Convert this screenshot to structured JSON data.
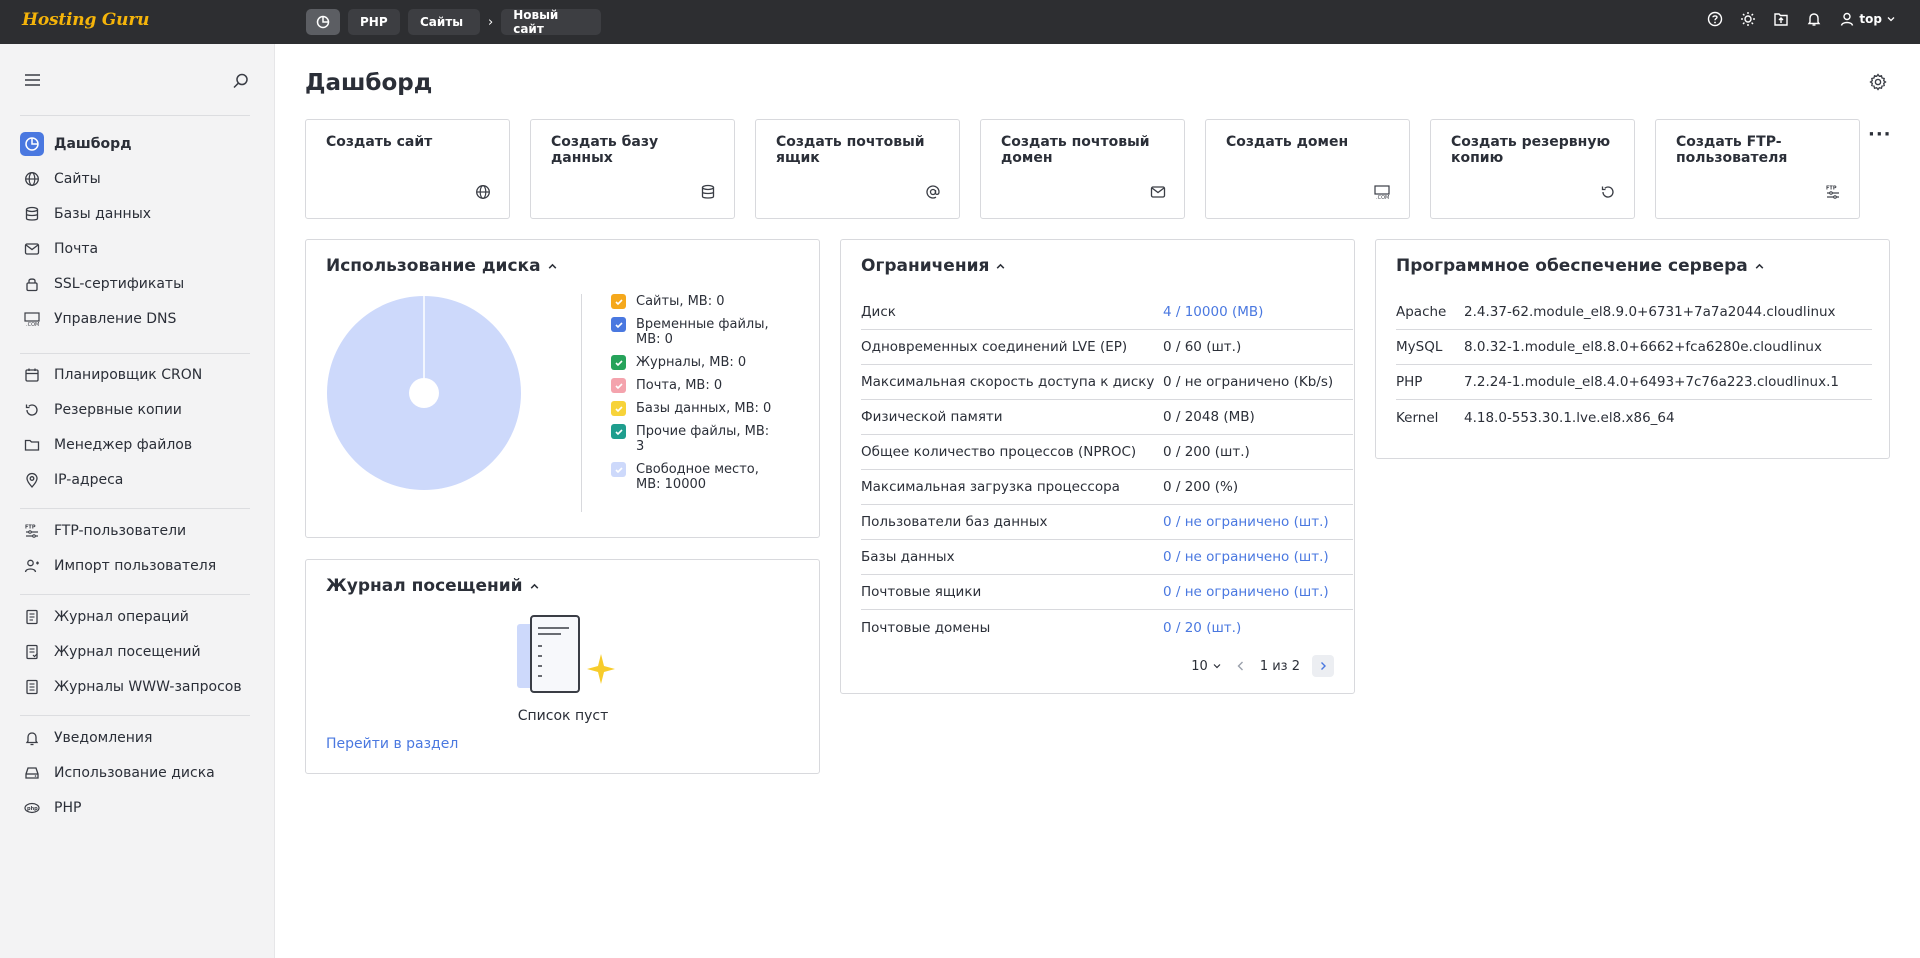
{
  "header": {
    "logo": "Hosting Guru",
    "breadcrumbs": [
      "PHP",
      "Сайты",
      "Новый сайт"
    ],
    "user": "top"
  },
  "sidebar": {
    "items": [
      {
        "label": "Дашборд",
        "icon": "dashboard-icon",
        "active": true
      },
      {
        "label": "Сайты",
        "icon": "globe-icon"
      },
      {
        "label": "Базы данных",
        "icon": "database-icon"
      },
      {
        "label": "Почта",
        "icon": "mail-icon"
      },
      {
        "label": "SSL-сертификаты",
        "icon": "lock-icon"
      },
      {
        "label": "Управление DNS",
        "icon": "dns-icon"
      },
      {
        "label": "Планировщик CRON",
        "icon": "calendar-icon"
      },
      {
        "label": "Резервные копии",
        "icon": "backup-icon"
      },
      {
        "label": "Менеджер файлов",
        "icon": "folder-icon"
      },
      {
        "label": "IP-адреса",
        "icon": "location-icon"
      },
      {
        "label": "FTP-пользователи",
        "icon": "ftp-icon"
      },
      {
        "label": "Импорт пользователя",
        "icon": "user-import-icon"
      },
      {
        "label": "Журнал операций",
        "icon": "log-icon"
      },
      {
        "label": "Журнал посещений",
        "icon": "visits-log-icon"
      },
      {
        "label": "Журналы WWW-запросов",
        "icon": "www-log-icon"
      },
      {
        "label": "Уведомления",
        "icon": "bell-icon"
      },
      {
        "label": "Использование диска",
        "icon": "disk-icon"
      },
      {
        "label": "PHP",
        "icon": "php-icon"
      }
    ]
  },
  "page": {
    "title": "Дашборд"
  },
  "quick_actions": [
    {
      "label": "Создать сайт",
      "icon": "globe-icon"
    },
    {
      "label": "Создать базу данных",
      "icon": "database-icon"
    },
    {
      "label": "Создать почтовый ящик",
      "icon": "at-icon"
    },
    {
      "label": "Создать почтовый домен",
      "icon": "mail-icon"
    },
    {
      "label": "Создать домен",
      "icon": "domain-com-icon"
    },
    {
      "label": "Создать резервную копию",
      "icon": "backup-icon"
    },
    {
      "label": "Создать FTP-пользователя",
      "icon": "ftp-icon"
    }
  ],
  "disk_usage": {
    "title": "Использование диска",
    "legend": [
      {
        "label": "Сайты, MB: 0",
        "color": "#f5a81c",
        "checked": true
      },
      {
        "label": "Временные файлы, MB: 0",
        "color": "#4a78e0",
        "checked": true
      },
      {
        "label": "Журналы, MB: 0",
        "color": "#26a35a",
        "checked": true
      },
      {
        "label": "Почта, MB: 0",
        "color": "#f4a3ad",
        "checked": true
      },
      {
        "label": "Базы данных, MB: 0",
        "color": "#f7d33a",
        "checked": true
      },
      {
        "label": "Прочие файлы, MB: 3",
        "color": "#1f9e8e",
        "checked": true
      },
      {
        "label": "Свободное место, MB: 10000",
        "color": "#cdd9fb",
        "checked": true
      }
    ],
    "pie_color": "#cdd9fb"
  },
  "limits": {
    "title": "Ограничения",
    "rows": [
      {
        "name": "Диск",
        "value": "4 / 10000 (MB)",
        "link": true
      },
      {
        "name": "Одновременных соединений LVE (EP)",
        "value": "0 / 60 (шт.)",
        "link": false
      },
      {
        "name": "Максимальная скорость доступа к диску",
        "value": "0 / не ограничено (Kb/s)",
        "link": false
      },
      {
        "name": "Физической памяти",
        "value": "0 / 2048 (MB)",
        "link": false
      },
      {
        "name": "Общее количество процессов (NPROC)",
        "value": "0 / 200 (шт.)",
        "link": false
      },
      {
        "name": "Максимальная загрузка процессора",
        "value": "0 / 200 (%)",
        "link": false
      },
      {
        "name": "Пользователи баз данных",
        "value": "0 / не ограничено (шт.)",
        "link": true
      },
      {
        "name": "Базы данных",
        "value": "0 / не ограничено (шт.)",
        "link": true
      },
      {
        "name": "Почтовые ящики",
        "value": "0 / не ограничено (шт.)",
        "link": true
      },
      {
        "name": "Почтовые домены",
        "value": "0 / 20 (шт.)",
        "link": true
      }
    ],
    "page_size": "10",
    "page_info": "1 из 2"
  },
  "software": {
    "title": "Программное обеспечение сервера",
    "rows": [
      {
        "name": "Apache",
        "version": "2.4.37-62.module_el8.9.0+6731+7a7a2044.cloudlinux"
      },
      {
        "name": "MySQL",
        "version": "8.0.32-1.module_el8.8.0+6662+fca6280e.cloudlinux"
      },
      {
        "name": "PHP",
        "version": "7.2.24-1.module_el8.4.0+6493+7c76a223.cloudlinux.1"
      },
      {
        "name": "Kernel",
        "version": "4.18.0-553.30.1.lve.el8.x86_64"
      }
    ]
  },
  "visits": {
    "title": "Журнал посещений",
    "empty_text": "Список пуст",
    "link_text": "Перейти в раздел"
  },
  "colors": {
    "accent": "#4a78e0",
    "topbar": "#2d2e31",
    "logo": "#f5b40a"
  }
}
